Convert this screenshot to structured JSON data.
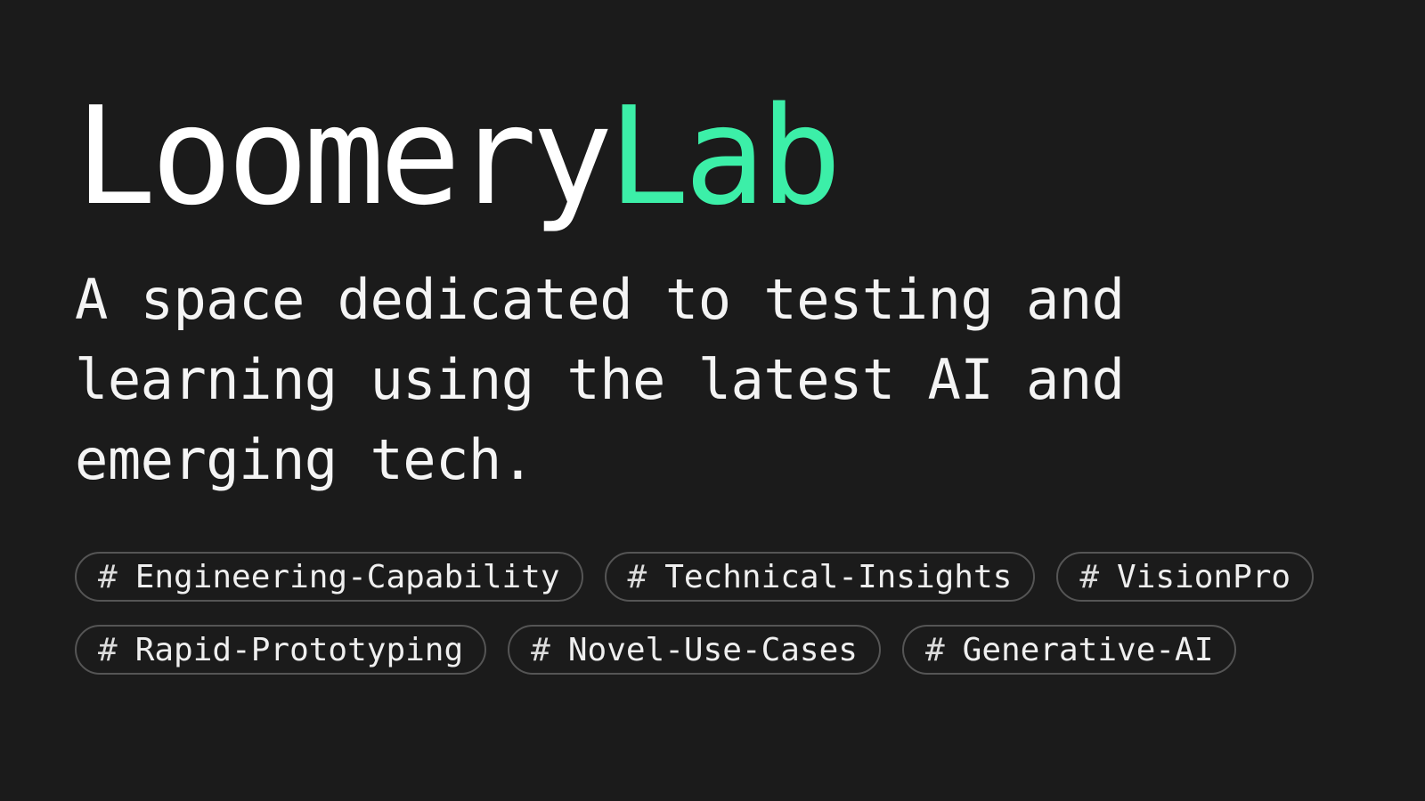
{
  "title": {
    "primary": "Loomery",
    "accent": "Lab",
    "accent_color": "#3cefa8"
  },
  "tagline": "A space dedicated to testing and learning using the latest AI and emerging tech.",
  "tags": [
    {
      "hash": "#",
      "label": "Engineering-Capability"
    },
    {
      "hash": "#",
      "label": "Technical-Insights"
    },
    {
      "hash": "#",
      "label": "VisionPro"
    },
    {
      "hash": "#",
      "label": "Rapid-Prototyping"
    },
    {
      "hash": "#",
      "label": "Novel-Use-Cases"
    },
    {
      "hash": "#",
      "label": "Generative-AI"
    }
  ]
}
